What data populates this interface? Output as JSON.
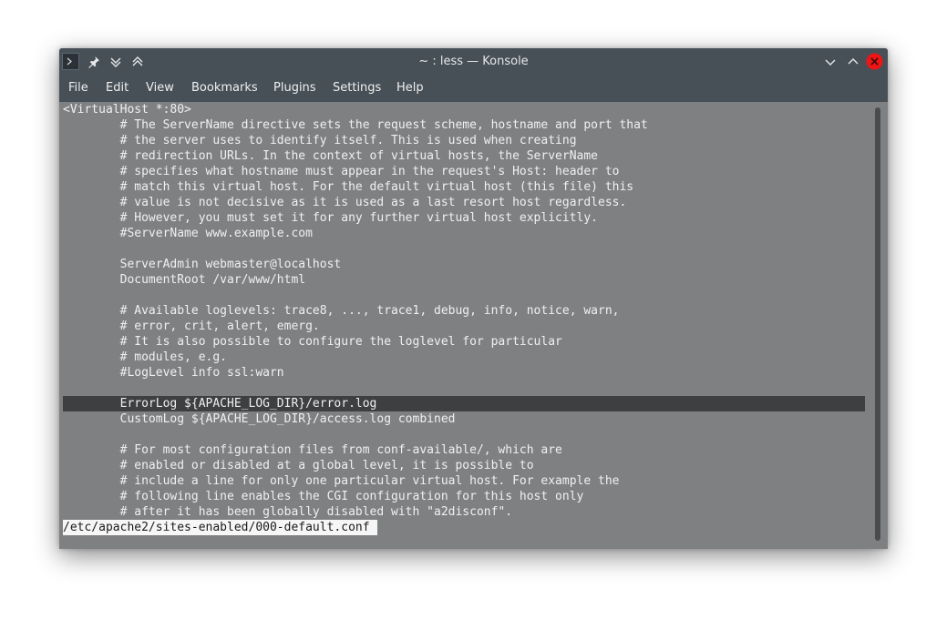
{
  "window": {
    "title": "~ : less — Konsole",
    "close_color": "#ed1515"
  },
  "titlebar_icons": [
    "terminal-app-icon",
    "pin-icon",
    "keep-below-icon",
    "keep-above-icon",
    "minimize-icon",
    "maximize-icon",
    "close-icon"
  ],
  "menu": [
    "File",
    "Edit",
    "View",
    "Bookmarks",
    "Plugins",
    "Settings",
    "Help"
  ],
  "terminal": {
    "lines": [
      "<VirtualHost *:80>",
      "        # The ServerName directive sets the request scheme, hostname and port that",
      "        # the server uses to identify itself. This is used when creating",
      "        # redirection URLs. In the context of virtual hosts, the ServerName",
      "        # specifies what hostname must appear in the request's Host: header to",
      "        # match this virtual host. For the default virtual host (this file) this",
      "        # value is not decisive as it is used as a last resort host regardless.",
      "        # However, you must set it for any further virtual host explicitly.",
      "        #ServerName www.example.com",
      "",
      "        ServerAdmin webmaster@localhost",
      "        DocumentRoot /var/www/html",
      "",
      "        # Available loglevels: trace8, ..., trace1, debug, info, notice, warn,",
      "        # error, crit, alert, emerg.",
      "        # It is also possible to configure the loglevel for particular",
      "        # modules, e.g.",
      "        #LogLevel info ssl:warn",
      "",
      "        ErrorLog ${APACHE_LOG_DIR}/error.log",
      "        CustomLog ${APACHE_LOG_DIR}/access.log combined",
      "",
      "        # For most configuration files from conf-available/, which are",
      "        # enabled or disabled at a global level, it is possible to",
      "        # include a line for only one particular virtual host. For example the",
      "        # following line enables the CGI configuration for this host only",
      "        # after it has been globally disabled with \"a2disconf\"."
    ],
    "highlighted_line": 19,
    "status_line": "/etc/apache2/sites-enabled/000-default.conf",
    "background": "#7f8082",
    "highlight_color": "#3e3f41"
  }
}
